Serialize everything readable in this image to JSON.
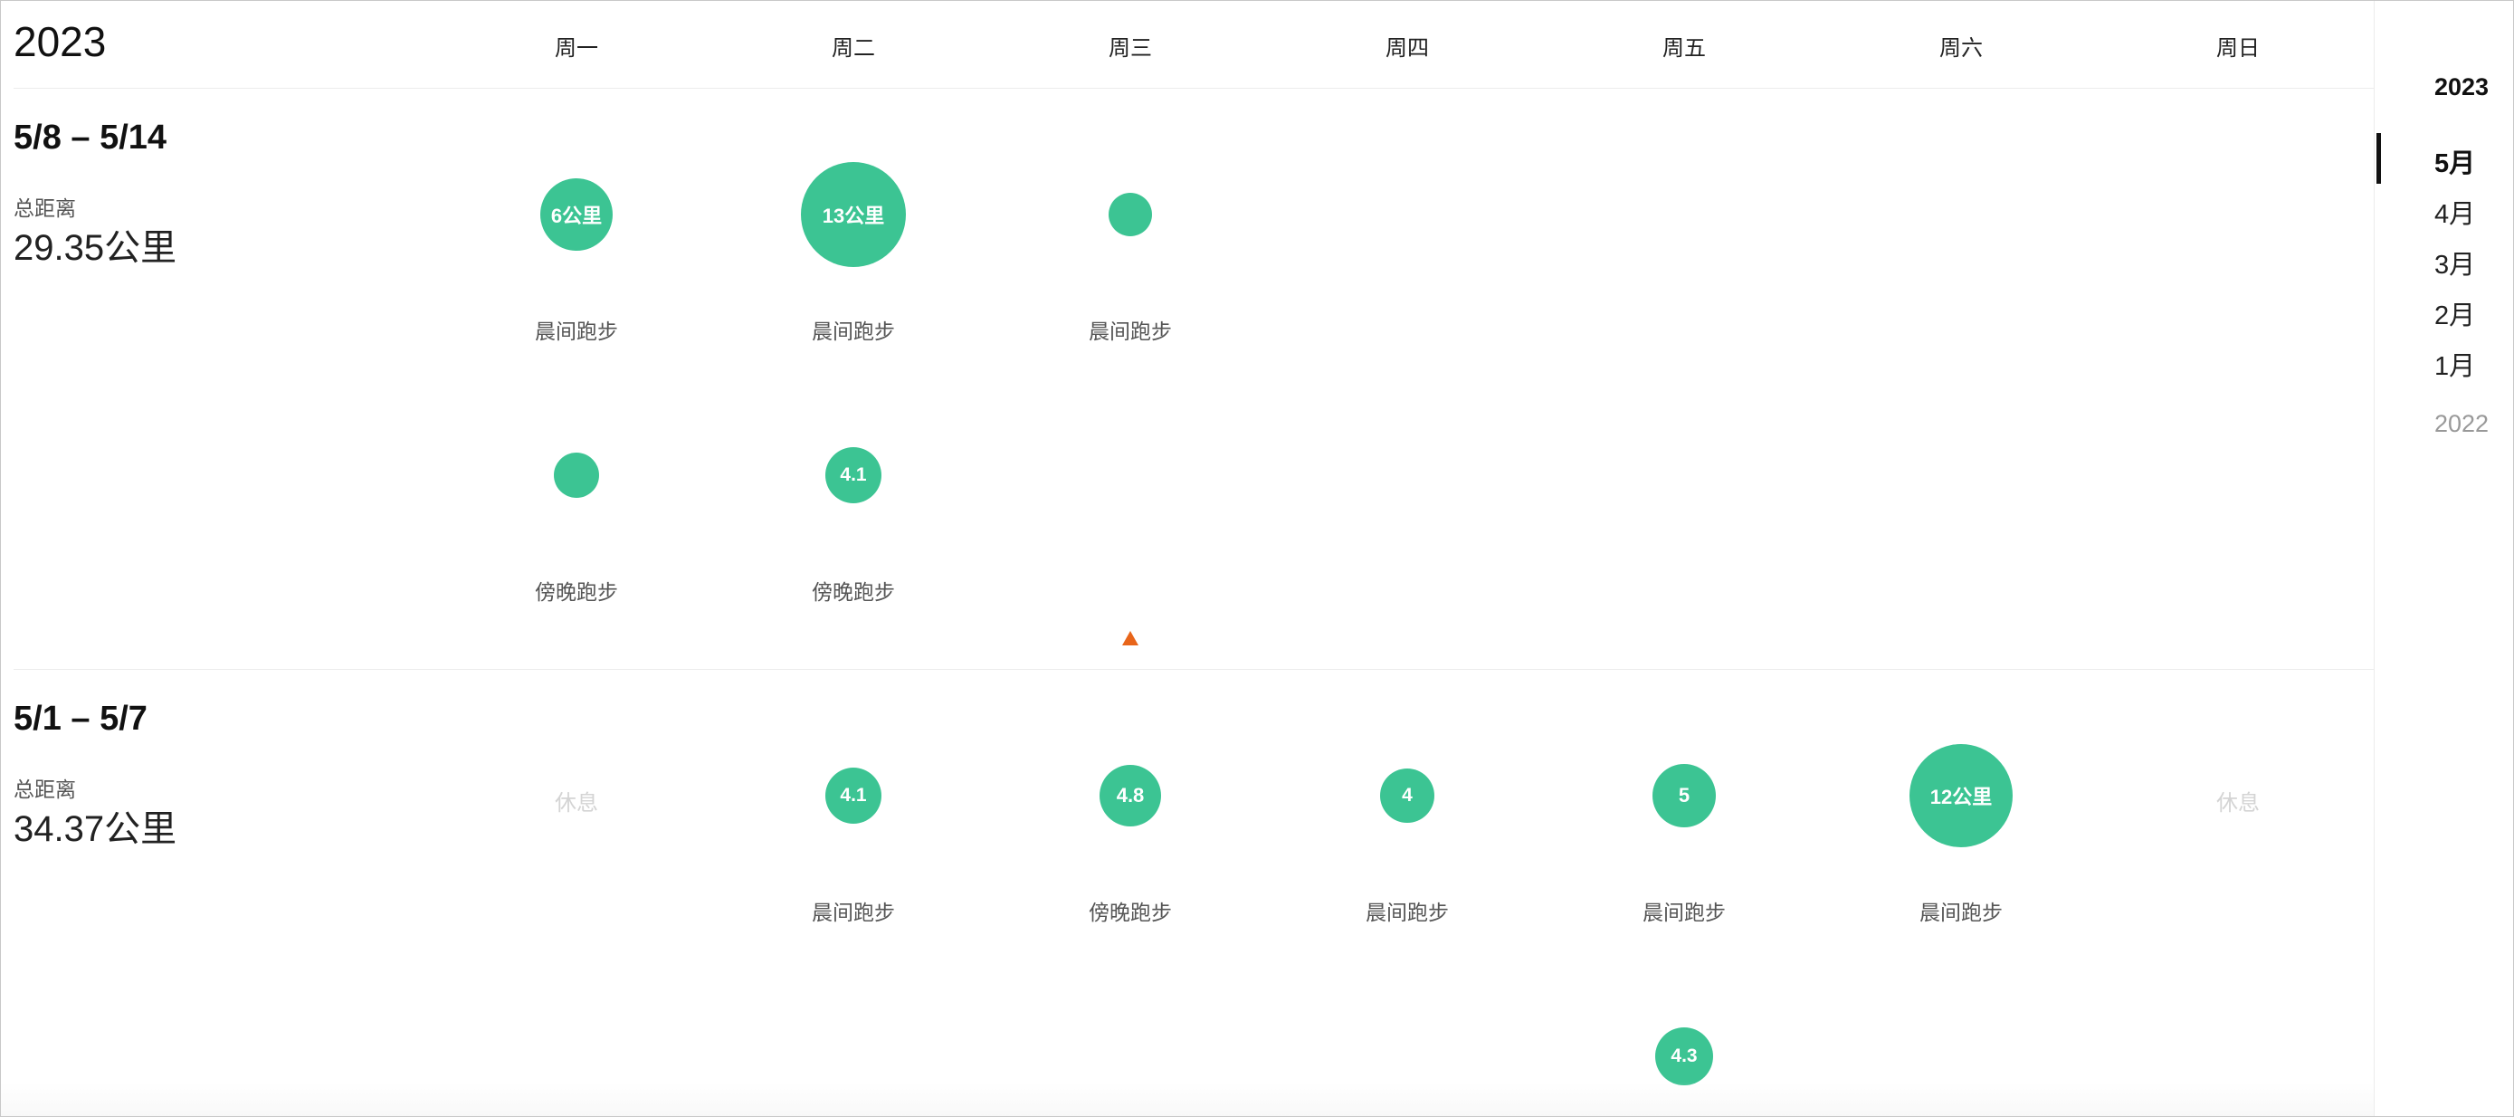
{
  "header": {
    "year": "2023"
  },
  "weekdays": [
    "周一",
    "周二",
    "周三",
    "周四",
    "周五",
    "周六",
    "周日"
  ],
  "weeks": [
    {
      "range": "5/8 – 5/14",
      "total_label": "总距离",
      "total_value": "29.35公里",
      "activities": [
        {
          "day": "周一",
          "label": "晨间跑步",
          "distance_text": "6公里"
        },
        {
          "day": "周二",
          "label": "晨间跑步",
          "distance_text": "13公里"
        },
        {
          "day": "周三",
          "label": "晨间跑步",
          "distance_text": ""
        },
        {
          "day": "周一",
          "label": "傍晚跑步",
          "distance_text": ""
        },
        {
          "day": "周二",
          "label": "傍晚跑步",
          "distance_text": "4.1"
        }
      ]
    },
    {
      "range": "5/1 – 5/7",
      "total_label": "总距离",
      "total_value": "34.37公里",
      "rest_label": "休息",
      "activities": [
        {
          "day": "周二",
          "label": "晨间跑步",
          "distance_text": "4.1"
        },
        {
          "day": "周三",
          "label": "傍晚跑步",
          "distance_text": "4.8"
        },
        {
          "day": "周四",
          "label": "晨间跑步",
          "distance_text": "4"
        },
        {
          "day": "周五",
          "label": "晨间跑步",
          "distance_text": "5"
        },
        {
          "day": "周六",
          "label": "晨间跑步",
          "distance_text": "12公里"
        },
        {
          "day": "周五",
          "label": "",
          "distance_text": "4.3"
        }
      ]
    }
  ],
  "sidebar": {
    "current_year": "2023",
    "months": [
      "5月",
      "4月",
      "3月",
      "2月",
      "1月"
    ],
    "active_month": "5月",
    "previous_year": "2022"
  },
  "colors": {
    "accent": "#3cc493",
    "marker": "#e8651a",
    "rest_text": "#d4d4d4"
  },
  "icons": {
    "today_marker": "triangle-up"
  }
}
